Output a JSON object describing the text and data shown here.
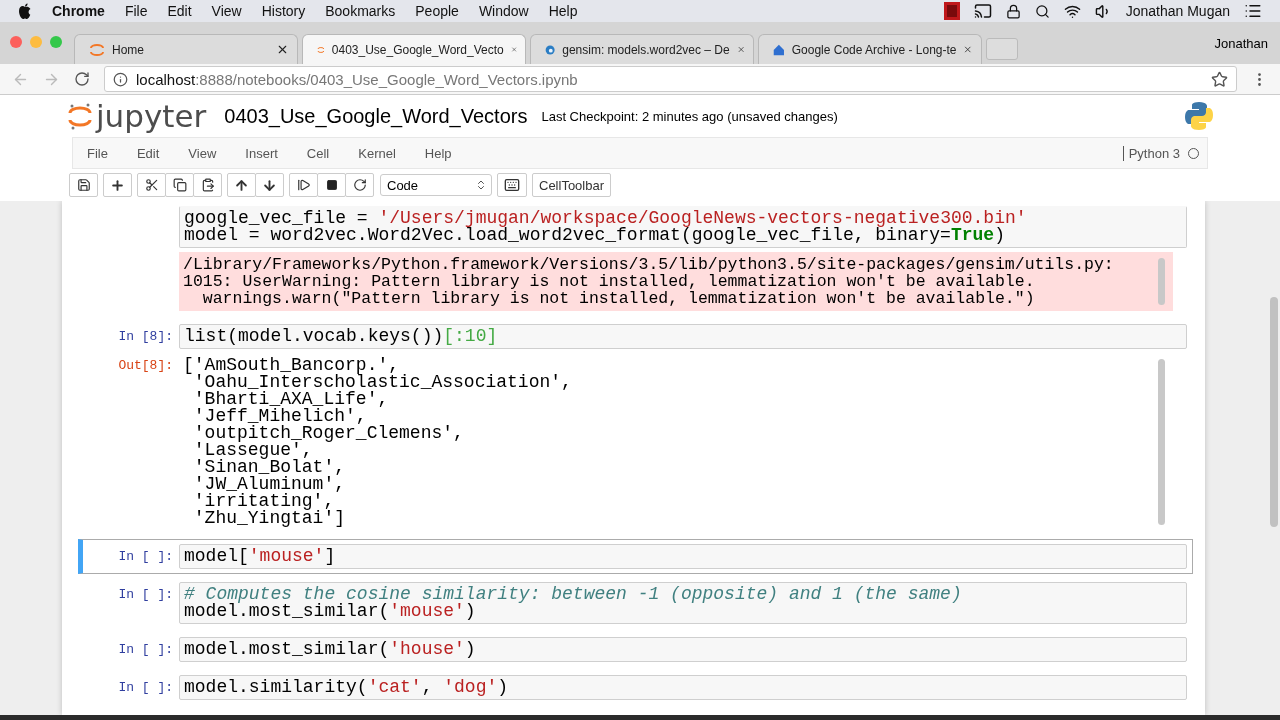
{
  "mac_menubar": {
    "app": "Chrome",
    "menus": [
      "File",
      "Edit",
      "View",
      "History",
      "Bookmarks",
      "People",
      "Window",
      "Help"
    ],
    "user": "Jonathan Mugan"
  },
  "browser": {
    "tabs": [
      {
        "title": "Home",
        "selected": false,
        "kind": "jupyter"
      },
      {
        "title": "0403_Use_Google_Word_Vecto",
        "selected": true,
        "kind": "jupyter"
      },
      {
        "title": "gensim: models.word2vec – De",
        "selected": false,
        "kind": "globe"
      },
      {
        "title": "Google Code Archive - Long-te",
        "selected": false,
        "kind": "house"
      }
    ],
    "profile": "Jonathan",
    "url_host": "localhost",
    "url_rest": ":8888/notebooks/0403_Use_Google_Word_Vectors.ipynb"
  },
  "notebook": {
    "logo": "jupyter",
    "title": "0403_Use_Google_Word_Vectors",
    "checkpoint": "Last Checkpoint: 2 minutes ago (unsaved changes)",
    "menu": [
      "File",
      "Edit",
      "View",
      "Insert",
      "Cell",
      "Kernel",
      "Help"
    ],
    "kernel": "Python 3",
    "kernel_busy": false,
    "cell_type": "Code",
    "celltoolbar": "CellToolbar",
    "cells": [
      {
        "selected": false,
        "input": [
          [
            {
              "kind": "plain",
              "text": "google_vec_file = "
            },
            {
              "kind": "str",
              "text": "'/Users/jmugan/workspace/GoogleNews-vectors-negative300.bin'"
            }
          ],
          [
            {
              "kind": "plain",
              "text": "model = word2vec.Word2Vec.load_word2vec_format(google_vec_file, binary="
            },
            {
              "kind": "kw",
              "text": "True"
            },
            {
              "kind": "plain",
              "text": ")"
            }
          ]
        ],
        "output": {
          "kind": "stderr",
          "lines": [
            "/Library/Frameworks/Python.framework/Versions/3.5/lib/python3.5/site-packages/gensim/utils.py:",
            "1015: UserWarning: Pattern library is not installed, lemmatization won't be available.",
            "  warnings.warn(\"Pattern library is not installed, lemmatization won't be available.\")"
          ]
        }
      },
      {
        "prompt": "In [8]:",
        "selected": false,
        "input": [
          [
            {
              "kind": "plain",
              "text": "list(model.vocab.keys())"
            },
            {
              "kind": "op",
              "text": "[:"
            },
            {
              "kind": "num",
              "text": "10"
            },
            {
              "kind": "op",
              "text": "]"
            }
          ]
        ],
        "output": {
          "kind": "result",
          "prompt": "Out[8]:",
          "lines": [
            "['AmSouth_Bancorp.',",
            " 'Oahu_Interscholastic_Association',",
            " 'Bharti_AXA_Life',",
            " 'Jeff_Mihelich',",
            " 'outpitch_Roger_Clemens',",
            " 'Lassegue',",
            " 'Sinan_Bolat',",
            " 'JW_Aluminum',",
            " 'irritating',",
            " 'Zhu_Yingtai']"
          ]
        }
      },
      {
        "prompt": "In [ ]:",
        "selected": true,
        "input": [
          [
            {
              "kind": "plain",
              "text": "model["
            },
            {
              "kind": "str",
              "text": "'mouse'"
            },
            {
              "kind": "plain",
              "text": "]"
            }
          ]
        ]
      },
      {
        "prompt": "In [ ]:",
        "selected": false,
        "input": [
          [
            {
              "kind": "comment",
              "text": "# Computes the cosine similarity: between -1 (opposite) and 1 (the same)"
            }
          ],
          [
            {
              "kind": "plain",
              "text": "model.most_similar("
            },
            {
              "kind": "str",
              "text": "'mouse'"
            },
            {
              "kind": "plain",
              "text": ")"
            }
          ]
        ]
      },
      {
        "prompt": "In [ ]:",
        "selected": false,
        "input": [
          [
            {
              "kind": "plain",
              "text": "model.most_similar("
            },
            {
              "kind": "str",
              "text": "'house'"
            },
            {
              "kind": "plain",
              "text": ")"
            }
          ]
        ]
      },
      {
        "prompt": "In [ ]:",
        "selected": false,
        "input": [
          [
            {
              "kind": "plain",
              "text": "model.similarity("
            },
            {
              "kind": "str",
              "text": "'cat'"
            },
            {
              "kind": "plain",
              "text": ", "
            },
            {
              "kind": "str",
              "text": "'dog'"
            },
            {
              "kind": "plain",
              "text": ")"
            }
          ]
        ]
      }
    ]
  }
}
